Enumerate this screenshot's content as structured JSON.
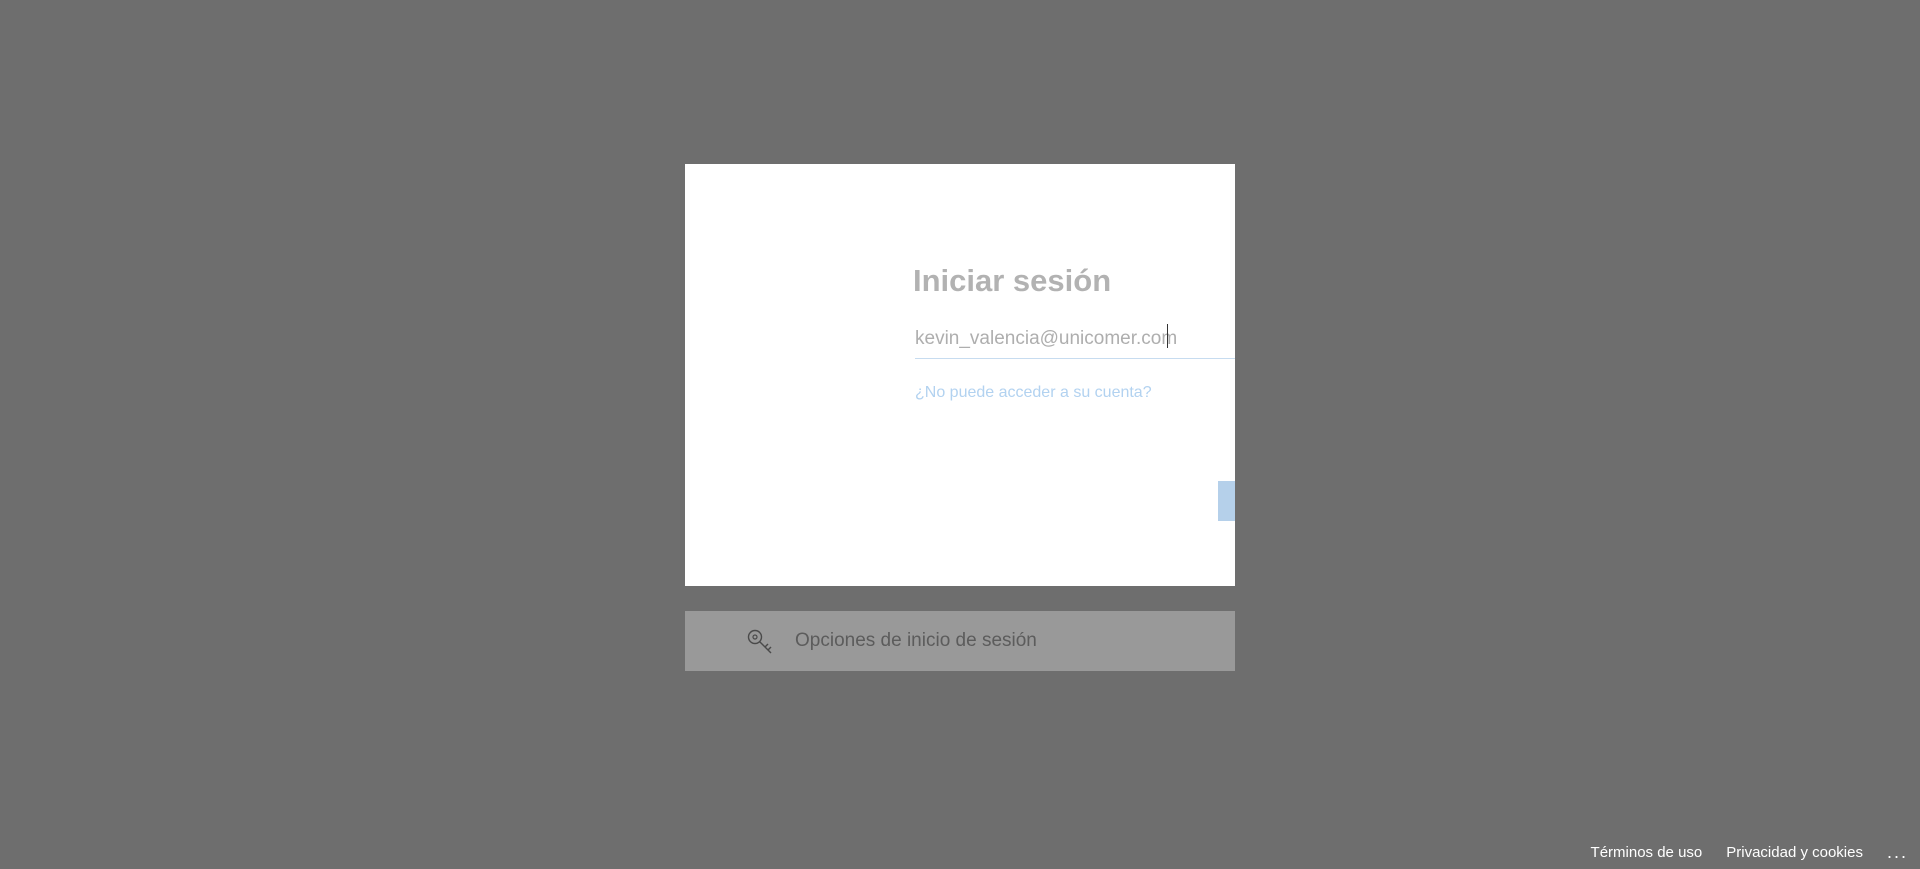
{
  "login": {
    "title": "Iniciar sesión",
    "email_value": "kevin_valencia@unicomer.com",
    "cant_access_link": "¿No puede acceder a su cuenta?"
  },
  "signin_options": {
    "label": "Opciones de inicio de sesión",
    "icon": "key-search-icon"
  },
  "footer": {
    "terms": "Términos de uso",
    "privacy": "Privacidad y cookies",
    "more": "..."
  },
  "colors": {
    "backdrop": "#6e6e6e",
    "card": "#ffffff",
    "accent_faded": "#b5d0ea",
    "link_faded": "#b2d2f0"
  }
}
